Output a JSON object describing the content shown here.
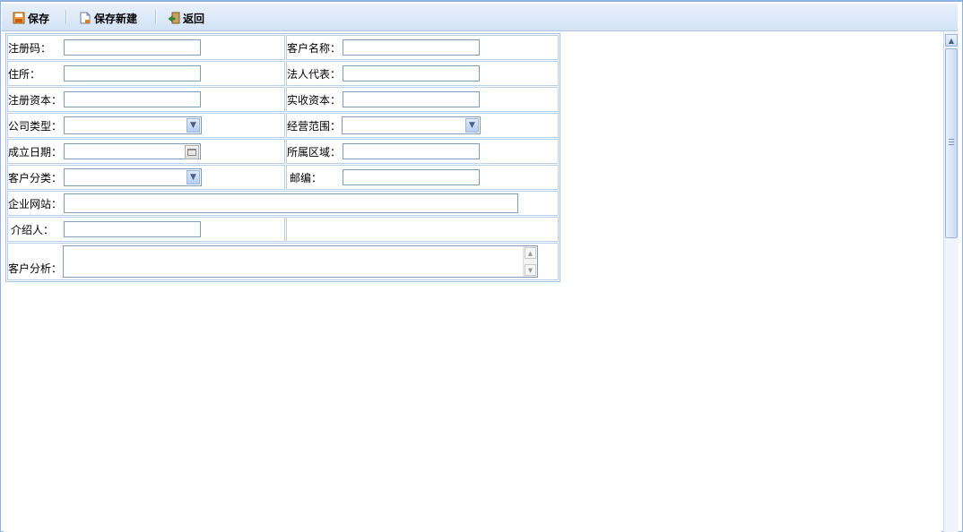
{
  "toolbar": {
    "save_label": "保存",
    "save_new_label": "保存新建",
    "back_label": "返回"
  },
  "form": {
    "reg_code_label": "注册码：",
    "customer_name_label": "客户名称：",
    "address_label": "住所：",
    "legal_rep_label": "法人代表：",
    "reg_capital_label": "注册资本：",
    "paid_capital_label": "实收资本：",
    "company_type_label": "公司类型：",
    "business_scope_label": "经营范围：",
    "founded_date_label": "成立日期：",
    "region_label": "所属区域：",
    "customer_category_label": "客户分类：",
    "postcode_label": "邮编：",
    "website_label": "企业网站：",
    "referrer_label": "介绍人：",
    "analysis_label": "客户分析：",
    "reg_code_value": "",
    "customer_name_value": "",
    "address_value": "",
    "legal_rep_value": "",
    "reg_capital_value": "",
    "paid_capital_value": "",
    "region_value": "",
    "postcode_value": "",
    "website_value": "",
    "referrer_value": "",
    "analysis_value": "",
    "company_type_selected": "",
    "business_scope_selected": "",
    "customer_category_selected": "",
    "founded_date_value": ""
  },
  "icons": {
    "save": "save-icon",
    "save_new": "new-document-icon",
    "back": "back-icon",
    "dropdown": "chevron-down-icon",
    "calendar": "calendar-icon"
  },
  "colors": {
    "toolbar_bg": "#d3e2f6",
    "border": "#a9c4e6",
    "input_border": "#7f9db9"
  }
}
